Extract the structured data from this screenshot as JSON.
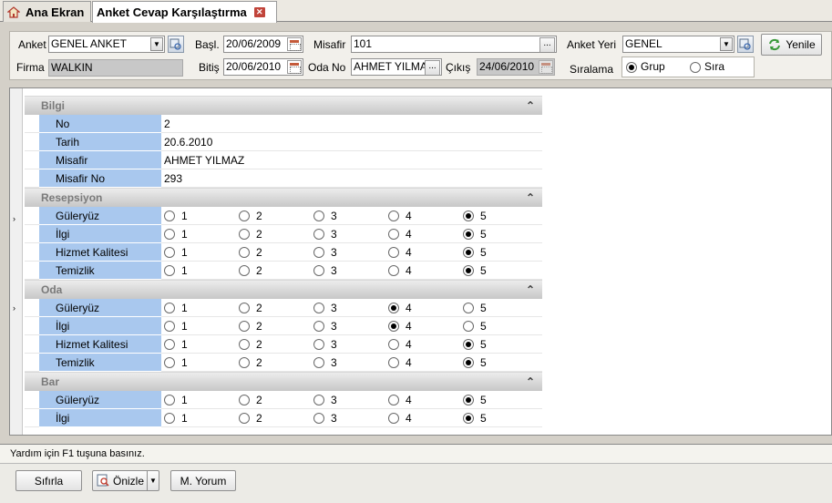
{
  "tabs": [
    {
      "label": "Ana Ekran"
    },
    {
      "label": "Anket Cevap Karşılaştırma"
    }
  ],
  "filter": {
    "anket_label": "Anket",
    "anket_value": "GENEL ANKET",
    "firma_label": "Firma",
    "firma_value": "WALKIN",
    "basl_label": "Başl.",
    "basl_value": "20/06/2009",
    "bitis_label": "Bitiş",
    "bitis_value": "20/06/2010",
    "misafir_label": "Misafir",
    "misafir_value": "101",
    "odano_label": "Oda No",
    "odano_value": "AHMET YILMAZ",
    "cikis_label": "Çıkış",
    "cikis_value": "24/06/2010",
    "anketyeri_label": "Anket Yeri",
    "anketyeri_value": "GENEL",
    "siralama_label": "Sıralama",
    "grup_label": "Grup",
    "sira_label": "Sıra",
    "yenile_label": "Yenile"
  },
  "sections": [
    {
      "title": "Bilgi",
      "rows": [
        {
          "key": "No",
          "value": "2"
        },
        {
          "key": "Tarih",
          "value": "20.6.2010"
        },
        {
          "key": "Misafir",
          "value": "AHMET YILMAZ"
        },
        {
          "key": "Misafir No",
          "value": "293"
        }
      ]
    },
    {
      "title": "Resepsiyon",
      "rows": [
        {
          "key": "Güleryüz",
          "selected": 5
        },
        {
          "key": "İlgi",
          "selected": 5
        },
        {
          "key": "Hizmet Kalitesi",
          "selected": 5
        },
        {
          "key": "Temizlik",
          "selected": 5
        }
      ]
    },
    {
      "title": "Oda",
      "rows": [
        {
          "key": "Güleryüz",
          "selected": 4
        },
        {
          "key": "İlgi",
          "selected": 4
        },
        {
          "key": "Hizmet Kalitesi",
          "selected": 5
        },
        {
          "key": "Temizlik",
          "selected": 5
        }
      ]
    },
    {
      "title": "Bar",
      "rows": [
        {
          "key": "Güleryüz",
          "selected": 5
        },
        {
          "key": "İlgi",
          "selected": 5
        }
      ]
    }
  ],
  "options": [
    "1",
    "2",
    "3",
    "4",
    "5"
  ],
  "status": "Yardım için F1 tuşuna basınız.",
  "buttons": {
    "sifirla": "Sıfırla",
    "onizle": "Önizle",
    "yorum": "M. Yorum"
  }
}
